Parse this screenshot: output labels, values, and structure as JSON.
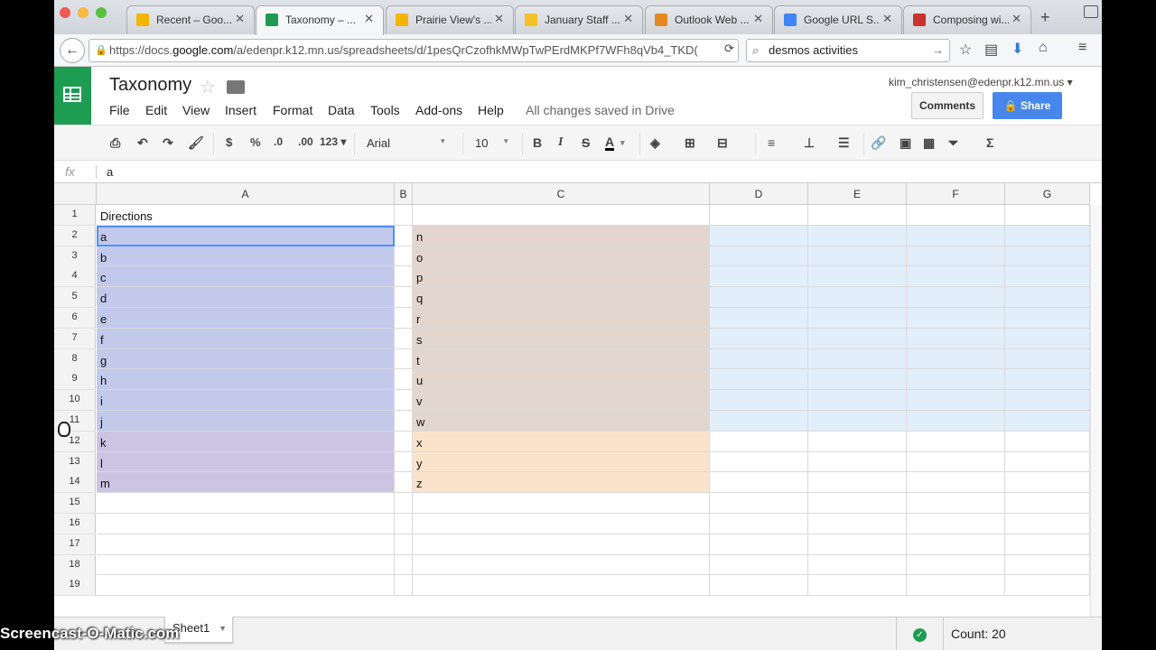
{
  "browser": {
    "tabs": [
      {
        "label": "Recent – Goo...",
        "favicon": "drive-icon",
        "color": "#f4b400"
      },
      {
        "label": "Taxonomy – ...",
        "favicon": "sheets-icon",
        "color": "#1e9c52"
      },
      {
        "label": "Prairie View's ...",
        "favicon": "drive-icon",
        "color": "#f4b400"
      },
      {
        "label": "January Staff ...",
        "favicon": "slides-icon",
        "color": "#f6c026"
      },
      {
        "label": "Outlook Web ...",
        "favicon": "outlook-icon",
        "color": "#e58a1f"
      },
      {
        "label": "Google URL S...",
        "favicon": "google-icon",
        "color": "#4285f4"
      },
      {
        "label": "Composing wi...",
        "favicon": "composing-icon",
        "color": "#c9322f"
      }
    ],
    "close_glyph": "✕",
    "url_prefix": "https://docs.",
    "url_domain": "google.com",
    "url_rest": "/a/edenpr.k12.mn.us/spreadsheets/d/1pesQrCzofhkMWpTwPErdMKPf7WFh8qVb4_TKD(",
    "search_query": "desmos activities"
  },
  "docs": {
    "title": "Taxonomy",
    "menus": [
      "File",
      "Edit",
      "View",
      "Insert",
      "Format",
      "Data",
      "Tools",
      "Add-ons",
      "Help"
    ],
    "save_status": "All changes saved in Drive",
    "user_email": "kim_christensen@edenpr.k12.mn.us",
    "comments_label": "Comments",
    "share_label": "Share"
  },
  "toolbar": {
    "currency": "$",
    "percent": "%",
    "dec_less": ".0",
    "dec_more": ".00",
    "more_formats": "123",
    "font": "Arial",
    "font_size": "10",
    "bold": "B",
    "italic": "I",
    "strike": "S",
    "text_color": "A"
  },
  "formula_bar": {
    "fx": "fx",
    "value": "a"
  },
  "sheet": {
    "columns": [
      "A",
      "B",
      "C",
      "D",
      "E",
      "F",
      "G"
    ],
    "rows": [
      {
        "num": "1",
        "a": "Directions",
        "c": ""
      },
      {
        "num": "2",
        "a": "a",
        "c": "n"
      },
      {
        "num": "3",
        "a": "b",
        "c": "o"
      },
      {
        "num": "4",
        "a": "c",
        "c": "p"
      },
      {
        "num": "5",
        "a": "d",
        "c": "q"
      },
      {
        "num": "6",
        "a": "e",
        "c": "r"
      },
      {
        "num": "7",
        "a": "f",
        "c": "s"
      },
      {
        "num": "8",
        "a": "g",
        "c": "t"
      },
      {
        "num": "9",
        "a": "h",
        "c": "u"
      },
      {
        "num": "10",
        "a": "i",
        "c": "v"
      },
      {
        "num": "11",
        "a": "j",
        "c": "w"
      },
      {
        "num": "12",
        "a": "k",
        "c": "x"
      },
      {
        "num": "13",
        "a": "l",
        "c": "y"
      },
      {
        "num": "14",
        "a": "m",
        "c": "z"
      },
      {
        "num": "15",
        "a": "",
        "c": ""
      },
      {
        "num": "16",
        "a": "",
        "c": ""
      },
      {
        "num": "17",
        "a": "",
        "c": ""
      },
      {
        "num": "18",
        "a": "",
        "c": ""
      },
      {
        "num": "19",
        "a": "",
        "c": ""
      }
    ],
    "colors": {
      "colA_upper": "#c3c9ea",
      "colA_lower": "#ccc4e3",
      "colC_upper": "#e3d6cf",
      "colC_lower": "#fbe3cb",
      "colDG_upper": "#e3eefb"
    }
  },
  "bottom": {
    "sheet_tab": "Sheet1",
    "count": "Count: 20"
  },
  "watermark": "Screencast-O-Matic.com"
}
